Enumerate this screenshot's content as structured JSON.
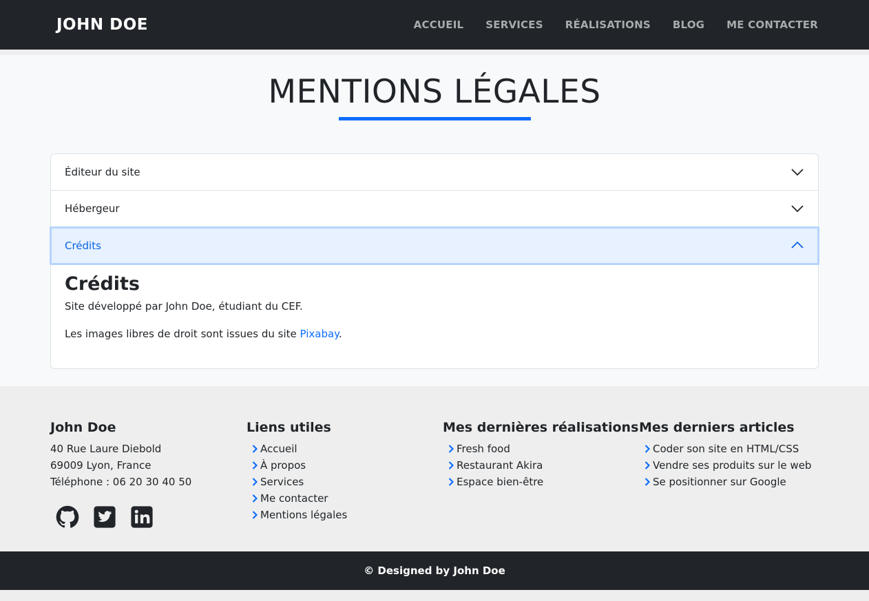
{
  "header": {
    "brand": "JOHN DOE",
    "nav": [
      "ACCUEIL",
      "SERVICES",
      "RÉALISATIONS",
      "BLOG",
      "ME CONTACTER"
    ]
  },
  "main": {
    "title": "MENTIONS LÉGALES",
    "accordion": [
      {
        "label": "Éditeur du site",
        "expanded": false
      },
      {
        "label": "Hébergeur",
        "expanded": false
      },
      {
        "label": "Crédits",
        "expanded": true
      }
    ],
    "credits": {
      "heading": "Crédits",
      "line1": "Site développé par John Doe, étudiant du CEF.",
      "line2_prefix": "Les images libres de droit sont issues du site ",
      "line2_link": "Pixabay",
      "line2_suffix": "."
    }
  },
  "footer": {
    "contact": {
      "title": "John Doe",
      "address1": "40 Rue Laure Diebold",
      "address2": "69009 Lyon, France",
      "phone": "Téléphone : 06 20 30 40 50",
      "socials": [
        "github-icon",
        "twitter-icon",
        "linkedin-icon"
      ]
    },
    "links": {
      "title": "Liens utiles",
      "items": [
        "Accueil",
        "À propos",
        "Services",
        "Me contacter",
        "Mentions légales"
      ]
    },
    "projects": {
      "title": "Mes dernières réalisations",
      "items": [
        "Fresh food",
        "Restaurant Akira",
        "Espace bien-être"
      ]
    },
    "articles": {
      "title": "Mes derniers articles",
      "items": [
        "Coder son site en HTML/CSS",
        "Vendre ses produits sur le web",
        "Se positionner sur Google"
      ]
    },
    "copyright": "© Designed by John Doe"
  },
  "colors": {
    "navbar": "#212529",
    "accent": "#0d6efd",
    "accordion_active_bg": "#e7f1ff",
    "accordion_active_text": "#0c63e4"
  }
}
